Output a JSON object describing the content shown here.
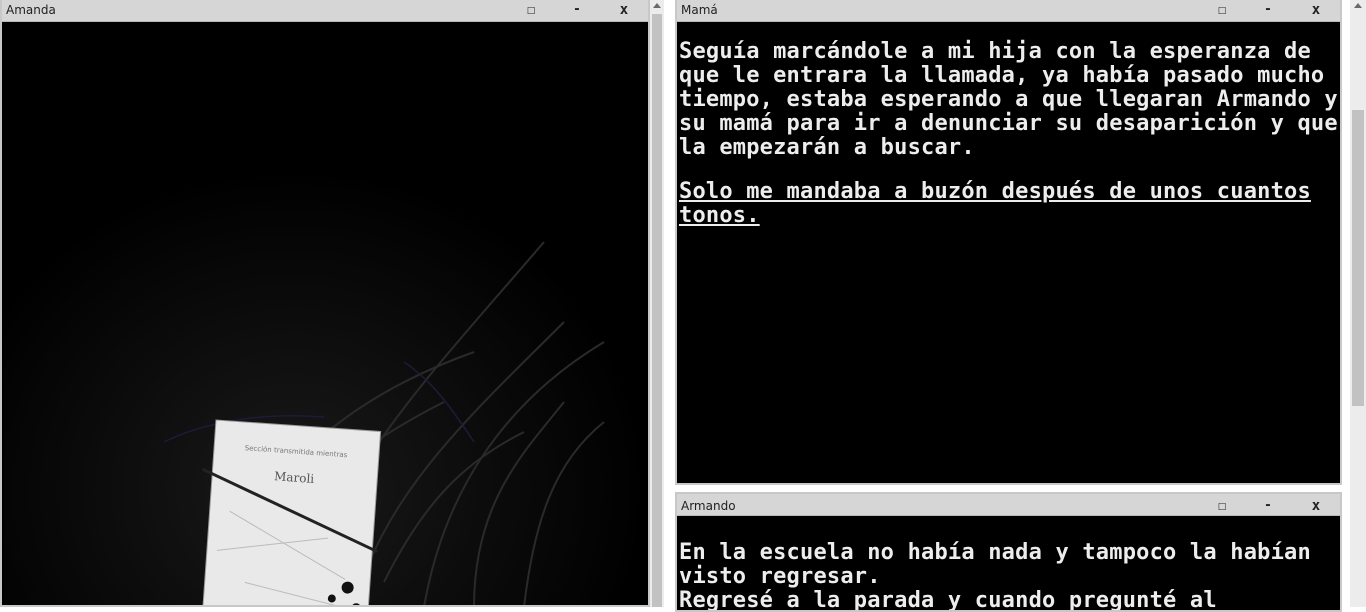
{
  "windows": {
    "amanda": {
      "title": "Amanda"
    },
    "mama": {
      "title": "Mamá",
      "paragraphs": [
        "Seguía marcándole a mi hija con la esperanza de que le entrara la llamada, ya había pasado mucho tiempo, estaba esperando a que llegaran Armando y su mamá para ir a denunciar su desaparición y que la empezarán a buscar.",
        "Solo me mandaba a buzón después de unos cuantos tonos."
      ]
    },
    "armando": {
      "title": "Armando",
      "paragraphs": [
        "En la escuela no había nada y tampoco la habían visto regresar.",
        "Regresé a la parada y cuando pregunté al"
      ]
    }
  },
  "controls": {
    "maximize": "□",
    "minimize": "-",
    "close": "x"
  },
  "scene": {
    "card_text_top": "Sección transmitida mientras",
    "card_name": "Maroli"
  },
  "colors": {
    "window_bg": "#000000",
    "titlebar": "#d6d6d6",
    "text": "#ededed"
  }
}
